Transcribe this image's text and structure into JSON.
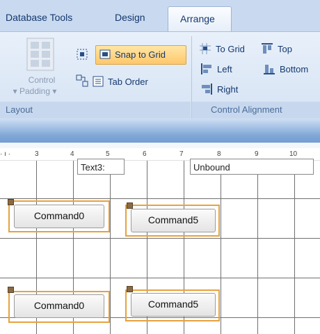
{
  "ribbon": {
    "tabs": [
      "Database Tools",
      "Design",
      "Arrange"
    ],
    "active_tab": "Arrange",
    "layout_group": {
      "label": "Layout",
      "control_padding_label_1": "Control",
      "control_padding_label_2": "Padding",
      "snap_to_grid": "Snap to Grid",
      "tab_order": "Tab Order"
    },
    "alignment_group": {
      "label": "Control Alignment",
      "to_grid": "To Grid",
      "top": "Top",
      "left": "Left",
      "bottom": "Bottom",
      "right": "Right"
    }
  },
  "ruler": {
    "marks": [
      "3",
      "4",
      "5",
      "6",
      "7",
      "8",
      "9",
      "10"
    ]
  },
  "form": {
    "field_1": "Text3:",
    "field_2": "Unbound",
    "row1": {
      "cmd_a": "Command0",
      "cmd_b": "Command5"
    },
    "row2": {
      "cmd_a": "Command0",
      "cmd_b": "Command5"
    }
  },
  "colors": {
    "accent": "#e6a23c",
    "ribbon_text": "#14386e"
  }
}
